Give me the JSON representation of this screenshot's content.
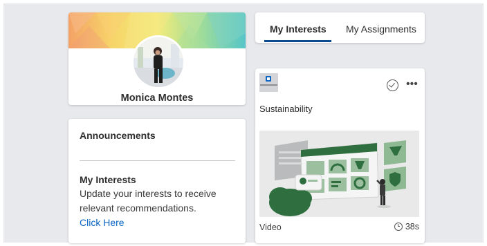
{
  "profile": {
    "name": "Monica Montes"
  },
  "announcements": {
    "title": "Announcements",
    "heading": "My Interests",
    "body": "Update your interests to receive relevant recommendations.",
    "link_label": "Click Here"
  },
  "tabs": [
    {
      "label": "My Interests",
      "active": true
    },
    {
      "label": "My Assignments",
      "active": false
    }
  ],
  "course": {
    "provider_icon": "linkedin-learning-logo",
    "title": "Sustainability",
    "type": "Video",
    "duration": "38s",
    "status_icon": "completed-check-icon",
    "more_icon": "more-options-icon"
  },
  "colors": {
    "page_background": "#e8e9ec",
    "link": "#0a66c2",
    "tab_underline": "#0a4a91",
    "thumbnail_green": "#2f6e3f"
  }
}
